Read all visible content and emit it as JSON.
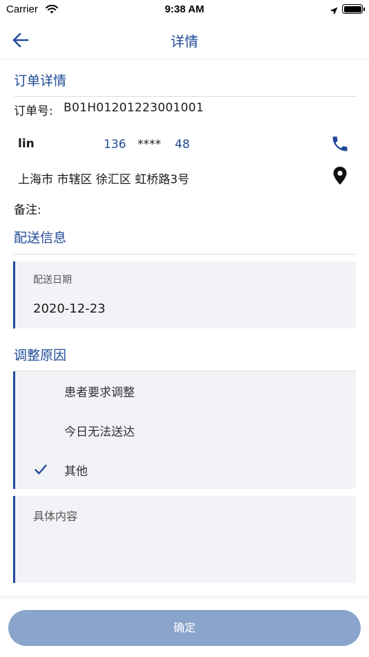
{
  "status_bar": {
    "carrier": "Carrier",
    "time": "9:38 AM",
    "icons": [
      "wifi-icon",
      "location-arrow-icon",
      "battery-icon"
    ]
  },
  "nav": {
    "title": "详情",
    "back_icon": "arrow-left-icon"
  },
  "order": {
    "section_title": "订单详情",
    "order_no_label": "订单号:",
    "order_no": "B01H01201223001001",
    "customer_name": "lin",
    "phone_prefix": "136",
    "phone_mask": "****",
    "phone_suffix": "48",
    "phone_icon": "phone-icon",
    "address": "上海市 市辖区 徐汇区 虹桥路3号",
    "map_icon": "map-pin-icon",
    "remark_label": "备注:"
  },
  "delivery": {
    "section_title": "配送信息",
    "date_label": "配送日期",
    "date_value": "2020-12-23"
  },
  "reason": {
    "section_title": "调整原因",
    "options": [
      {
        "label": "患者要求调整",
        "selected": false
      },
      {
        "label": "今日无法送达",
        "selected": false
      },
      {
        "label": "其他",
        "selected": true
      }
    ],
    "detail_placeholder": "具体内容"
  },
  "footer": {
    "confirm_label": "确定"
  },
  "colors": {
    "accent": "#1f4a96",
    "card_bg": "#f2f3f7",
    "button_bg": "#8aa4cb"
  }
}
